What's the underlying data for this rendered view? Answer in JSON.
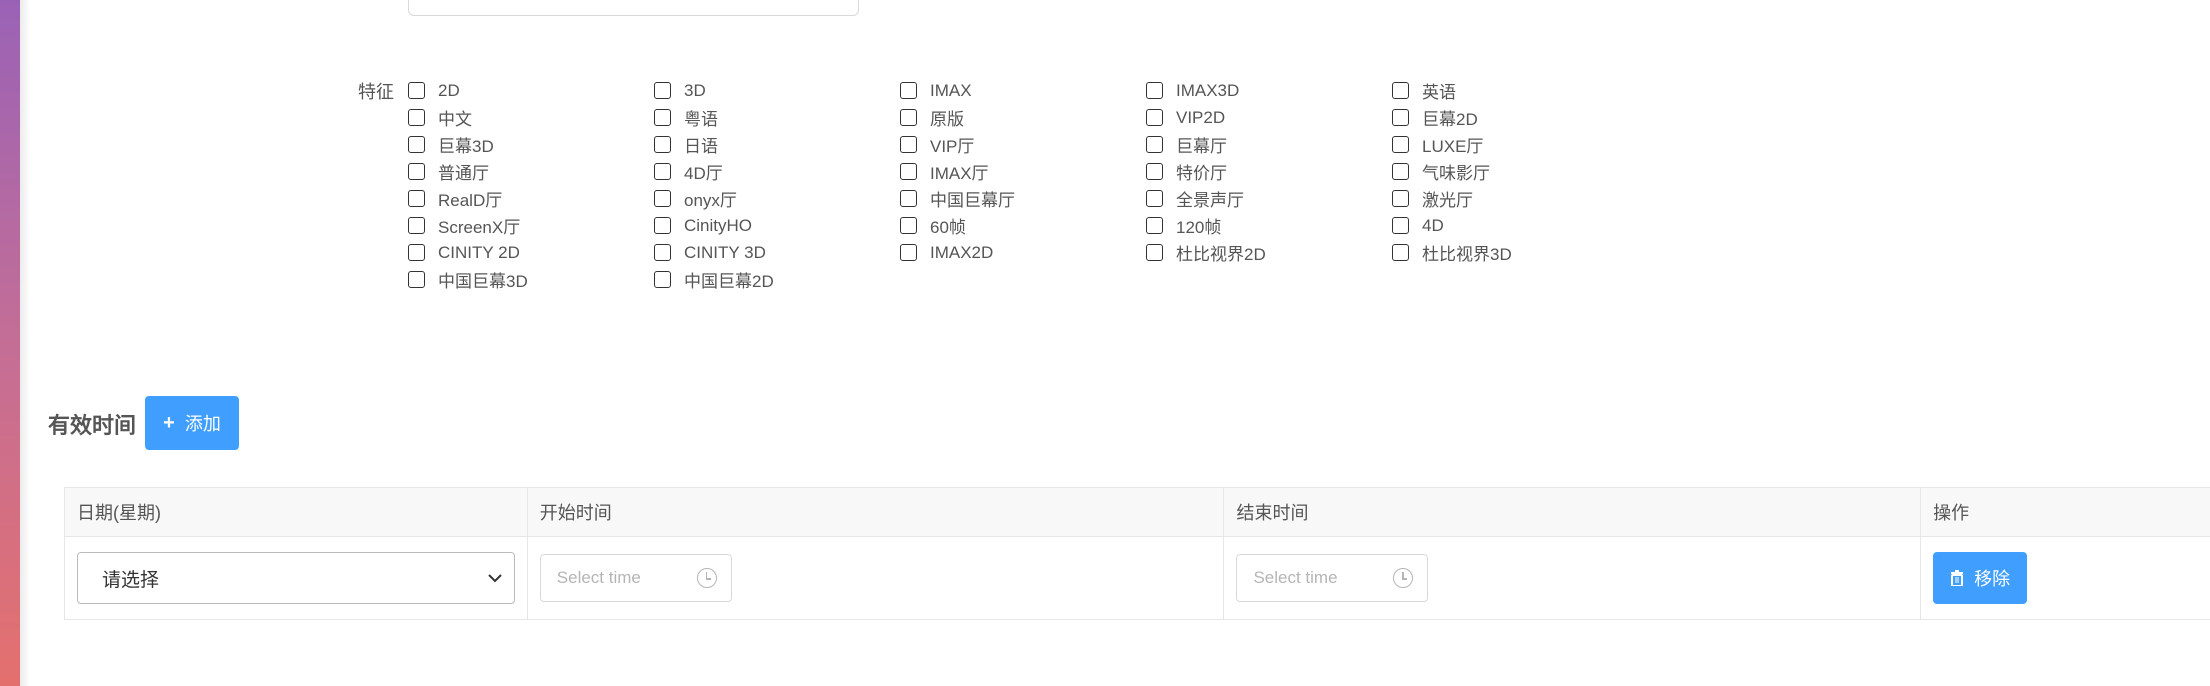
{
  "features": {
    "label": "特征",
    "items": [
      "2D",
      "3D",
      "IMAX",
      "IMAX3D",
      "英语",
      "中文",
      "粤语",
      "原版",
      "VIP2D",
      "巨幕2D",
      "巨幕3D",
      "日语",
      "VIP厅",
      "巨幕厅",
      "LUXE厅",
      "普通厅",
      "4D厅",
      "IMAX厅",
      "特价厅",
      "气味影厅",
      "RealD厅",
      "onyx厅",
      "中国巨幕厅",
      "全景声厅",
      "激光厅",
      "ScreenX厅",
      "CinityHO",
      "60帧",
      "120帧",
      "4D",
      "CINITY 2D",
      "CINITY 3D",
      "IMAX2D",
      "杜比视界2D",
      "杜比视界3D",
      "中国巨幕3D",
      "中国巨幕2D"
    ]
  },
  "valid_time": {
    "title": "有效时间",
    "add_label": "添加"
  },
  "table": {
    "headers": [
      "日期(星期)",
      "开始时间",
      "结束时间",
      "操作"
    ],
    "row": {
      "date_select_value": "请选择",
      "start_placeholder": "Select time",
      "end_placeholder": "Select time",
      "remove_label": "移除"
    }
  },
  "colors": {
    "primary": "#409eff",
    "sidebar_top": "#9a62b6",
    "sidebar_bottom": "#e4706e"
  }
}
